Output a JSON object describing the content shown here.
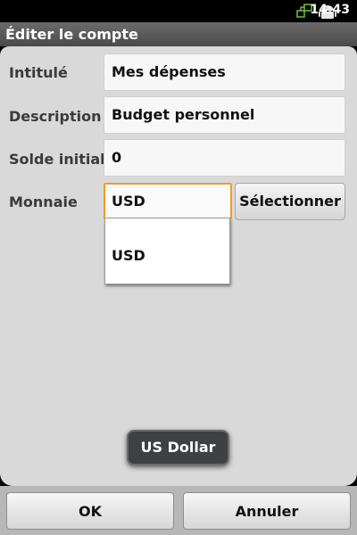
{
  "status_bar": {
    "time": "14:43",
    "icons": [
      "network-sync-icon",
      "android-icon"
    ]
  },
  "title": "Éditer le compte",
  "form": {
    "name_label": "Intitulé",
    "name_value": "Mes dépenses",
    "description_label": "Description",
    "description_value": "Budget personnel",
    "balance_label": "Solde initial",
    "balance_value": "0",
    "currency_label": "Monnaie",
    "currency_value": "USD",
    "select_button": "Sélectionner"
  },
  "dropdown": {
    "items": [
      "USD"
    ]
  },
  "toast": "US Dollar",
  "buttons": {
    "ok": "OK",
    "cancel": "Annuler"
  },
  "colors": {
    "focus_border": "#f59a23",
    "status_icon_green": "#6fc33c"
  }
}
